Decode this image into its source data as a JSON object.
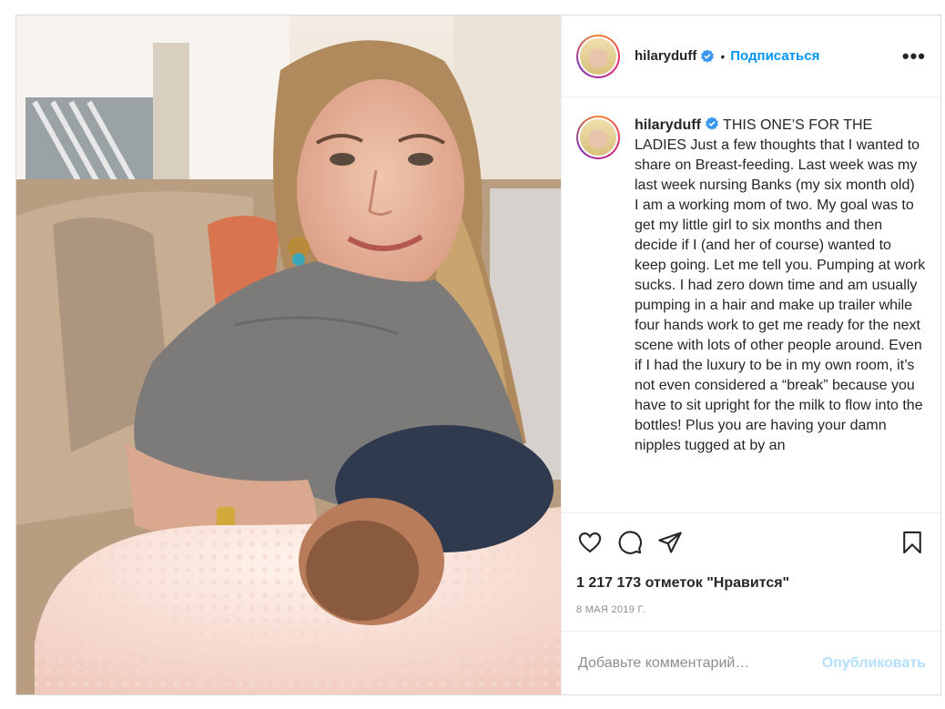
{
  "post": {
    "author": "hilaryduff",
    "follow_label": "Подписаться",
    "separator": "•",
    "more_label": "•••",
    "caption": " THIS ONE’S FOR THE LADIES Just a few thoughts that I wanted to share on Breast-feeding. Last week was my last week nursing Banks (my six month old)\nI am a working mom of two. My goal was to get my little girl to six months and then decide if I (and her of course) wanted to keep going. Let me tell you. Pumping at work sucks. I had zero down time and am usually pumping in a hair and make up trailer while four hands work to get me ready for the next scene with lots of other people around. Even if I had the luxury to be in my own room, it’s not even considered a “break” because you have to sit upright for the milk to flow into the bottles! Plus you are having your damn nipples tugged at by an",
    "likes_text": "1 217 173 отметок \"Нравится\"",
    "date": "8 МАЯ 2019 Г.",
    "comment_placeholder": "Добавьте комментарий…",
    "publish_label": "Опубликовать"
  },
  "icons": {
    "verified": "verified-badge-icon",
    "like": "heart-icon",
    "comment": "comment-icon",
    "share": "paper-plane-icon",
    "save": "bookmark-icon"
  },
  "colors": {
    "accent": "#0095f6",
    "publish_disabled": "#b2dffc",
    "border": "#dbdbdb",
    "text": "#262626",
    "muted": "#8e8e8e"
  }
}
